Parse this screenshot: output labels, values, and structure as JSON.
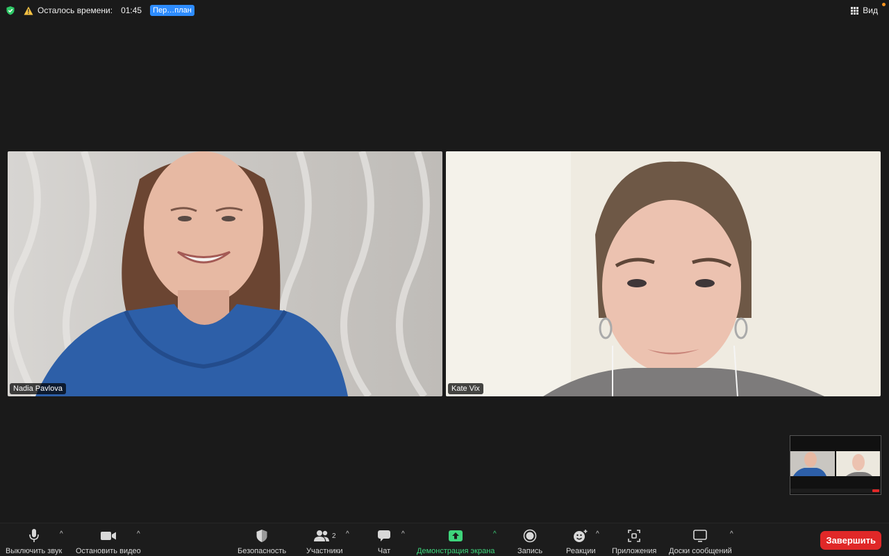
{
  "topbar": {
    "time_label": "Осталось времени:",
    "time_value": "01:45",
    "upgrade_label": "Пер…план",
    "view_label": "Вид"
  },
  "participants": [
    {
      "name": "Nadia Pavlova"
    },
    {
      "name": "Kate Vix"
    }
  ],
  "toolbar": {
    "mute_label": "Выключить звук",
    "video_label": "Остановить видео",
    "security_label": "Безопасность",
    "participants_label": "Участники",
    "participants_count": "2",
    "chat_label": "Чат",
    "share_label": "Демонстрация экрана",
    "record_label": "Запись",
    "reactions_label": "Реакции",
    "apps_label": "Приложения",
    "whiteboards_label": "Доски сообщений",
    "end_label": "Завершить"
  },
  "colors": {
    "accent_blue": "#2d8cff",
    "share_green": "#3ed47b",
    "end_red": "#e02828",
    "secure_green": "#2ec866"
  }
}
